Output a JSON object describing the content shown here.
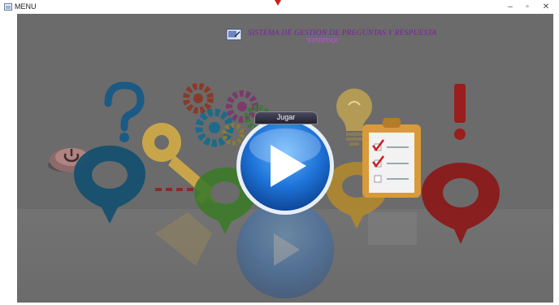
{
  "window": {
    "title": "MENU",
    "minimize_glyph": "–",
    "maximize_glyph": "▫",
    "close_glyph": "✕"
  },
  "header": {
    "title": "SISTEMA DE GESTION DE PREGUNTAS Y RESPUESTA",
    "subtitle": "\"EXPERTSQL\"",
    "icon": "document-icon"
  },
  "play": {
    "label": "Jugar",
    "icon": "play-icon"
  },
  "colors": {
    "background": "#6b6b6b",
    "title_purple": "#7b1fa2",
    "subtitle_magenta": "#e040fb",
    "play_blue": "#1e73d8",
    "marker_red": "#d11d1d"
  },
  "decorations": [
    "settings-gears-icon",
    "question-mark-icon",
    "key-icon",
    "power-button-icon",
    "lightbulb-icon",
    "clipboard-checklist-icon",
    "exclamation-mark-icon",
    "location-pin-icon"
  ]
}
